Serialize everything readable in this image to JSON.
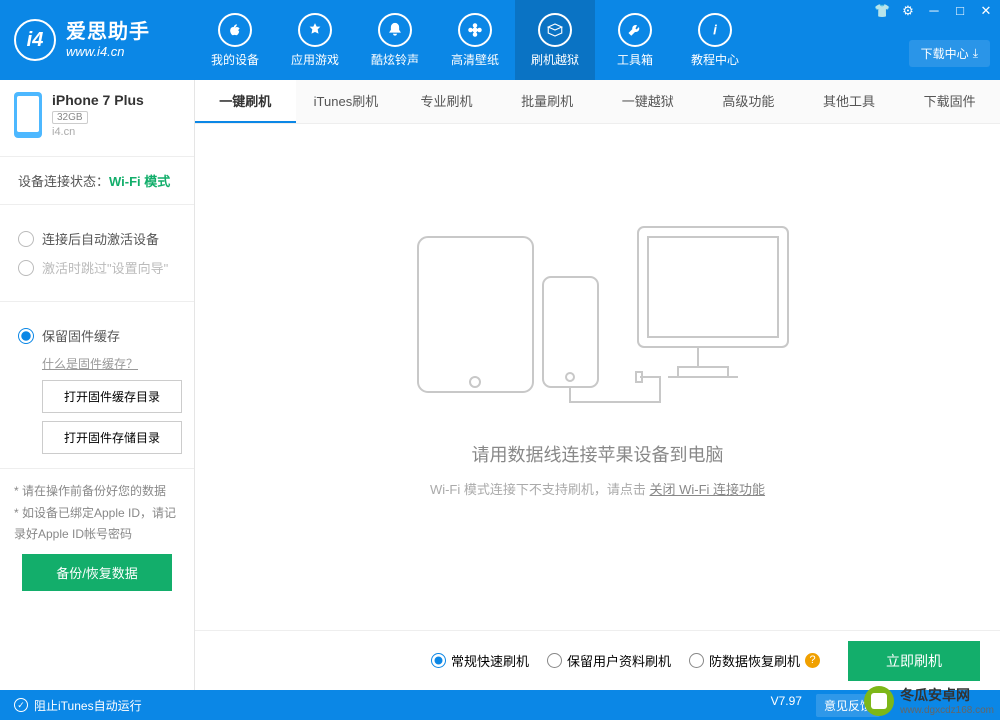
{
  "app": {
    "title": "爱思助手",
    "subtitle": "www.i4.cn"
  },
  "win": {
    "download_center": "下载中心"
  },
  "nav": [
    {
      "label": "我的设备"
    },
    {
      "label": "应用游戏"
    },
    {
      "label": "酷炫铃声"
    },
    {
      "label": "高清壁纸"
    },
    {
      "label": "刷机越狱"
    },
    {
      "label": "工具箱"
    },
    {
      "label": "教程中心"
    }
  ],
  "sidebar": {
    "device_name": "iPhone 7 Plus",
    "capacity": "32GB",
    "device_sub": "i4.cn",
    "status_label": "设备连接状态：",
    "status_value": "Wi-Fi 模式",
    "opt_auto_activate": "连接后自动激活设备",
    "opt_skip_wizard": "激活时跳过\"设置向导\"",
    "opt_keep_fw": "保留固件缓存",
    "what_is_fw": "什么是固件缓存？",
    "btn_open_fw_cache": "打开固件缓存目录",
    "btn_open_fw_store": "打开固件存储目录",
    "tip1": "* 请在操作前备份好您的数据",
    "tip2": "* 如设备已绑定Apple ID，请记录好Apple ID帐号密码",
    "btn_backup": "备份/恢复数据"
  },
  "tabs": [
    "一键刷机",
    "iTunes刷机",
    "专业刷机",
    "批量刷机",
    "一键越狱",
    "高级功能",
    "其他工具",
    "下载固件"
  ],
  "content": {
    "message": "请用数据线连接苹果设备到电脑",
    "sub_prefix": "Wi-Fi 模式连接下不支持刷机，请点击",
    "sub_link": "关闭 Wi-Fi 连接功能"
  },
  "options": {
    "fast": "常规快速刷机",
    "keep": "保留用户资料刷机",
    "anti": "防数据恢复刷机",
    "flash_btn": "立即刷机"
  },
  "footer": {
    "block_itunes": "阻止iTunes自动运行",
    "version": "V7.97",
    "feedback": "意见反馈"
  },
  "watermark": {
    "line1": "冬瓜安卓网",
    "line2": "www.dgxcdz168.com"
  }
}
